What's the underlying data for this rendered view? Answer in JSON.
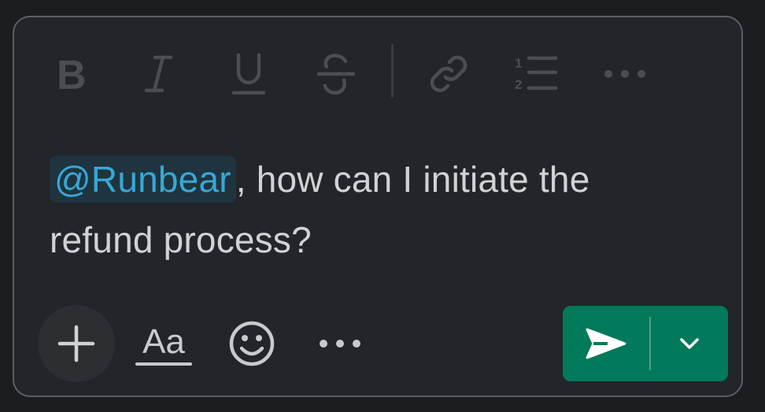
{
  "toolbar": {
    "bold": "bold-icon",
    "italic": "italic-icon",
    "underline": "underline-icon",
    "strikethrough": "strikethrough-icon",
    "link": "link-icon",
    "ordered_list": "ordered-list-icon",
    "more": "more-horizontal-icon"
  },
  "message": {
    "mention": "@Runbear",
    "text": ", how can I initiate the refund process?"
  },
  "bottom_bar": {
    "attach_icon": "plus-icon",
    "formatting_label": "Aa",
    "emoji_icon": "emoji-icon",
    "more_icon": "more-horizontal-icon",
    "send_icon": "send-icon",
    "send_options_icon": "chevron-down-icon"
  },
  "colors": {
    "background": "#1b1d21",
    "composer": "#222529",
    "mention_text": "#36a8d6",
    "mention_bg": "#1f343f",
    "send_button": "#007a5a",
    "disabled_icon": "#4b4d51"
  }
}
